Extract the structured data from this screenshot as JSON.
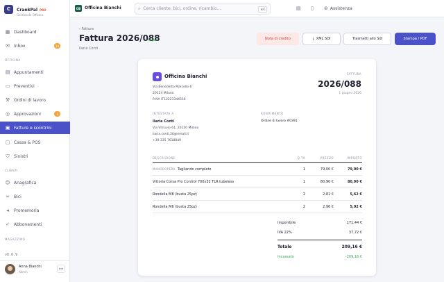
{
  "brand": {
    "name": "CrankPal",
    "badge": "PRO",
    "subtitle": "Gestionale Officina",
    "logo_letter": "C"
  },
  "sidebar": {
    "items": [
      {
        "label": "Dashboard",
        "icon": "grid-icon"
      },
      {
        "label": "Inbox",
        "icon": "inbox-icon",
        "count": "14"
      },
      {
        "label": "Appuntamenti",
        "icon": "calendar-icon"
      },
      {
        "label": "Preventivi",
        "icon": "file-icon"
      },
      {
        "label": "Ordini di lavoro",
        "icon": "wrench-icon"
      },
      {
        "label": "Approvazioni",
        "icon": "check-circle-icon",
        "count": "3"
      },
      {
        "label": "Fatture e scontrini",
        "icon": "receipt-icon",
        "active": true
      },
      {
        "label": "Cassa & POS",
        "icon": "cash-icon"
      },
      {
        "label": "Sinistri",
        "icon": "shield-icon"
      },
      {
        "label": "Anagrafica",
        "icon": "users-icon"
      },
      {
        "label": "Bici",
        "icon": "bike-icon"
      },
      {
        "label": "Promemoria",
        "icon": "megaphone-icon"
      },
      {
        "label": "Abbonamenti",
        "icon": "badge-icon"
      }
    ],
    "sections": [
      "OFFICINA",
      "CLIENTI",
      "MAGAZZINO"
    ],
    "version": "v0.6.9",
    "user": {
      "name": "Anna Bianchi",
      "role": "Admin"
    }
  },
  "topbar": {
    "shop_logo": "OB",
    "shop_name": "Officina Bianchi",
    "search_placeholder": "Cerca cliente, bici, ordine, ricambio...",
    "search_shortcut": "⌘K",
    "assist_label": "Assistenza"
  },
  "page": {
    "breadcrumb": "‹ Fatture",
    "title": "Fattura 2026/088",
    "status": "• Pagata",
    "customer": "Ilaria Conti",
    "buttons": {
      "credit_note": "Nota di credito",
      "xml": "XML SDI",
      "send_sdi": "Trasmetti allo SdI",
      "print": "Stampa / PDF"
    }
  },
  "invoice": {
    "company": "Officina Bianchi",
    "company_address": [
      "Via Benedetto Marcello 6",
      "20124 Milano",
      "P.IVA IT12223344556"
    ],
    "doc_label": "FATTURA",
    "number": "2026/088",
    "date": "1 giugno 2026",
    "billed_to_label": "INTESTATA A",
    "billed_to_name": "Ilaria Conti",
    "billed_to_lines": [
      "Via Vitruvio 61, 20120 Milano",
      "ilaria.conti.26@email.it",
      "+39 335 7618849"
    ],
    "reference_label": "RIFERIMENTO",
    "reference_value": "Ordine di lavoro #0391",
    "columns": {
      "desc": "DESCRIZIONE",
      "qty": "Q.TÀ",
      "price": "PREZZO",
      "total": "IMPORTO"
    },
    "lines": [
      {
        "tag": "MANODOPERA",
        "desc": "Tagliando completo",
        "qty": "1",
        "price": "79,00 €",
        "total": "79,00 €"
      },
      {
        "tag": "",
        "desc": "Vittoria Corsa Pro Control 700x32 TLR tubeless",
        "qty": "1",
        "price": "80,90 €",
        "total": "80,90 €"
      },
      {
        "tag": "",
        "desc": "Rondella M8 (busta 25pz)",
        "qty": "2",
        "price": "2,81 €",
        "total": "5,62 €"
      },
      {
        "tag": "",
        "desc": "Rondella M6 (busta 25pz)",
        "qty": "2",
        "price": "2,96 €",
        "total": "5,92 €"
      }
    ],
    "totals": {
      "taxable_label": "Imponibile",
      "taxable": "171,44 €",
      "vat_label": "IVA 22%",
      "vat": "37,72 €",
      "total_label": "Totale",
      "total": "209,16 €",
      "paid_label": "Incassato",
      "paid": "-209,16 €"
    }
  }
}
